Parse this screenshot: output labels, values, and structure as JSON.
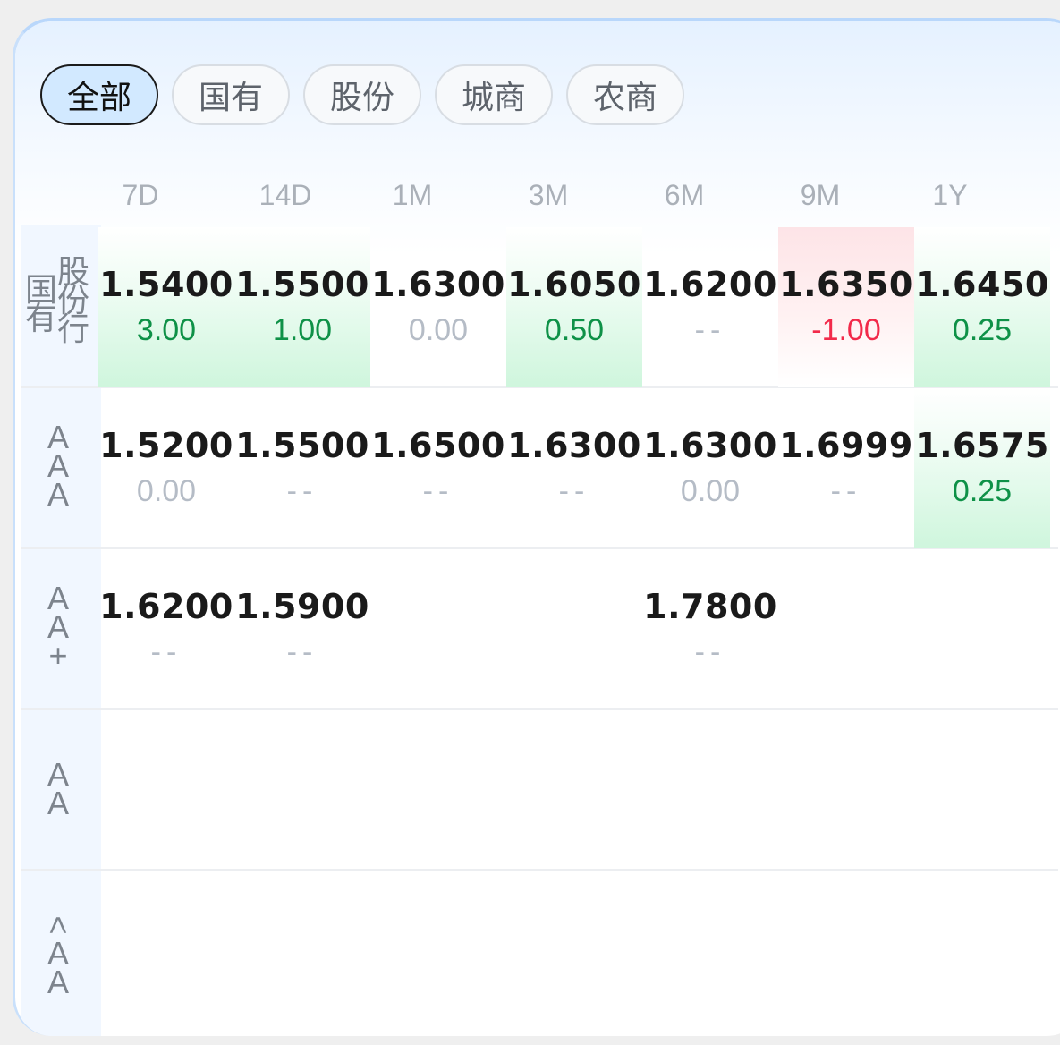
{
  "tabs": [
    {
      "label": "全部",
      "active": true
    },
    {
      "label": "国有",
      "active": false
    },
    {
      "label": "股份",
      "active": false
    },
    {
      "label": "城商",
      "active": false
    },
    {
      "label": "农商",
      "active": false
    }
  ],
  "columns": [
    "7D",
    "14D",
    "1M",
    "3M",
    "6M",
    "9M",
    "1Y"
  ],
  "rows": [
    {
      "label_left": "国有",
      "label_right": "股份行",
      "cells": [
        {
          "value": "1.5400",
          "change": "3.00",
          "trend": "up"
        },
        {
          "value": "1.5500",
          "change": "1.00",
          "trend": "up"
        },
        {
          "value": "1.6300",
          "change": "0.00",
          "trend": "zero"
        },
        {
          "value": "1.6050",
          "change": "0.50",
          "trend": "up"
        },
        {
          "value": "1.6200",
          "change": "--",
          "trend": "none"
        },
        {
          "value": "1.6350",
          "change": "-1.00",
          "trend": "down"
        },
        {
          "value": "1.6450",
          "change": "0.25",
          "trend": "up"
        }
      ]
    },
    {
      "label": "AAA",
      "cells": [
        {
          "value": "1.5200",
          "change": "0.00",
          "trend": "zero"
        },
        {
          "value": "1.5500",
          "change": "--",
          "trend": "none"
        },
        {
          "value": "1.6500",
          "change": "--",
          "trend": "none"
        },
        {
          "value": "1.6300",
          "change": "--",
          "trend": "none"
        },
        {
          "value": "1.6300",
          "change": "0.00",
          "trend": "zero"
        },
        {
          "value": "1.6999",
          "change": "--",
          "trend": "none"
        },
        {
          "value": "1.6575",
          "change": "0.25",
          "trend": "up"
        }
      ]
    },
    {
      "label": "AA+",
      "cells": [
        {
          "value": "1.6200",
          "change": "--",
          "trend": "none"
        },
        {
          "value": "1.5900",
          "change": "--",
          "trend": "none"
        },
        null,
        null,
        {
          "value": "1.7800",
          "change": "--",
          "trend": "none"
        },
        null,
        null
      ]
    },
    {
      "label": "AA",
      "cells": [
        null,
        null,
        null,
        null,
        null,
        null,
        null
      ]
    },
    {
      "label": "<AA",
      "cells": [
        null,
        null,
        null,
        null,
        null,
        null,
        null
      ]
    }
  ]
}
